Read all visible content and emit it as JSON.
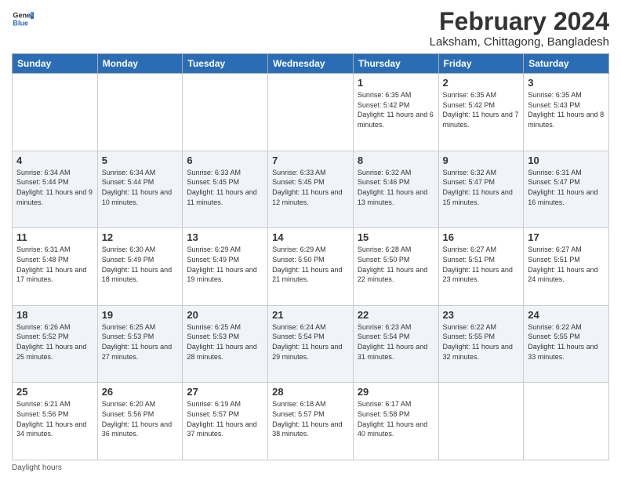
{
  "header": {
    "logo_general": "General",
    "logo_blue": "Blue",
    "month_year": "February 2024",
    "location": "Laksham, Chittagong, Bangladesh"
  },
  "days_of_week": [
    "Sunday",
    "Monday",
    "Tuesday",
    "Wednesday",
    "Thursday",
    "Friday",
    "Saturday"
  ],
  "weeks": [
    [
      {
        "day": "",
        "info": ""
      },
      {
        "day": "",
        "info": ""
      },
      {
        "day": "",
        "info": ""
      },
      {
        "day": "",
        "info": ""
      },
      {
        "day": "1",
        "info": "Sunrise: 6:35 AM\nSunset: 5:42 PM\nDaylight: 11 hours\nand 6 minutes."
      },
      {
        "day": "2",
        "info": "Sunrise: 6:35 AM\nSunset: 5:42 PM\nDaylight: 11 hours\nand 7 minutes."
      },
      {
        "day": "3",
        "info": "Sunrise: 6:35 AM\nSunset: 5:43 PM\nDaylight: 11 hours\nand 8 minutes."
      }
    ],
    [
      {
        "day": "4",
        "info": "Sunrise: 6:34 AM\nSunset: 5:44 PM\nDaylight: 11 hours\nand 9 minutes."
      },
      {
        "day": "5",
        "info": "Sunrise: 6:34 AM\nSunset: 5:44 PM\nDaylight: 11 hours\nand 10 minutes."
      },
      {
        "day": "6",
        "info": "Sunrise: 6:33 AM\nSunset: 5:45 PM\nDaylight: 11 hours\nand 11 minutes."
      },
      {
        "day": "7",
        "info": "Sunrise: 6:33 AM\nSunset: 5:45 PM\nDaylight: 11 hours\nand 12 minutes."
      },
      {
        "day": "8",
        "info": "Sunrise: 6:32 AM\nSunset: 5:46 PM\nDaylight: 11 hours\nand 13 minutes."
      },
      {
        "day": "9",
        "info": "Sunrise: 6:32 AM\nSunset: 5:47 PM\nDaylight: 11 hours\nand 15 minutes."
      },
      {
        "day": "10",
        "info": "Sunrise: 6:31 AM\nSunset: 5:47 PM\nDaylight: 11 hours\nand 16 minutes."
      }
    ],
    [
      {
        "day": "11",
        "info": "Sunrise: 6:31 AM\nSunset: 5:48 PM\nDaylight: 11 hours\nand 17 minutes."
      },
      {
        "day": "12",
        "info": "Sunrise: 6:30 AM\nSunset: 5:49 PM\nDaylight: 11 hours\nand 18 minutes."
      },
      {
        "day": "13",
        "info": "Sunrise: 6:29 AM\nSunset: 5:49 PM\nDaylight: 11 hours\nand 19 minutes."
      },
      {
        "day": "14",
        "info": "Sunrise: 6:29 AM\nSunset: 5:50 PM\nDaylight: 11 hours\nand 21 minutes."
      },
      {
        "day": "15",
        "info": "Sunrise: 6:28 AM\nSunset: 5:50 PM\nDaylight: 11 hours\nand 22 minutes."
      },
      {
        "day": "16",
        "info": "Sunrise: 6:27 AM\nSunset: 5:51 PM\nDaylight: 11 hours\nand 23 minutes."
      },
      {
        "day": "17",
        "info": "Sunrise: 6:27 AM\nSunset: 5:51 PM\nDaylight: 11 hours\nand 24 minutes."
      }
    ],
    [
      {
        "day": "18",
        "info": "Sunrise: 6:26 AM\nSunset: 5:52 PM\nDaylight: 11 hours\nand 25 minutes."
      },
      {
        "day": "19",
        "info": "Sunrise: 6:25 AM\nSunset: 5:53 PM\nDaylight: 11 hours\nand 27 minutes."
      },
      {
        "day": "20",
        "info": "Sunrise: 6:25 AM\nSunset: 5:53 PM\nDaylight: 11 hours\nand 28 minutes."
      },
      {
        "day": "21",
        "info": "Sunrise: 6:24 AM\nSunset: 5:54 PM\nDaylight: 11 hours\nand 29 minutes."
      },
      {
        "day": "22",
        "info": "Sunrise: 6:23 AM\nSunset: 5:54 PM\nDaylight: 11 hours\nand 31 minutes."
      },
      {
        "day": "23",
        "info": "Sunrise: 6:22 AM\nSunset: 5:55 PM\nDaylight: 11 hours\nand 32 minutes."
      },
      {
        "day": "24",
        "info": "Sunrise: 6:22 AM\nSunset: 5:55 PM\nDaylight: 11 hours\nand 33 minutes."
      }
    ],
    [
      {
        "day": "25",
        "info": "Sunrise: 6:21 AM\nSunset: 5:56 PM\nDaylight: 11 hours\nand 34 minutes."
      },
      {
        "day": "26",
        "info": "Sunrise: 6:20 AM\nSunset: 5:56 PM\nDaylight: 11 hours\nand 36 minutes."
      },
      {
        "day": "27",
        "info": "Sunrise: 6:19 AM\nSunset: 5:57 PM\nDaylight: 11 hours\nand 37 minutes."
      },
      {
        "day": "28",
        "info": "Sunrise: 6:18 AM\nSunset: 5:57 PM\nDaylight: 11 hours\nand 38 minutes."
      },
      {
        "day": "29",
        "info": "Sunrise: 6:17 AM\nSunset: 5:58 PM\nDaylight: 11 hours\nand 40 minutes."
      },
      {
        "day": "",
        "info": ""
      },
      {
        "day": "",
        "info": ""
      }
    ]
  ],
  "footer": {
    "note": "Daylight hours"
  }
}
